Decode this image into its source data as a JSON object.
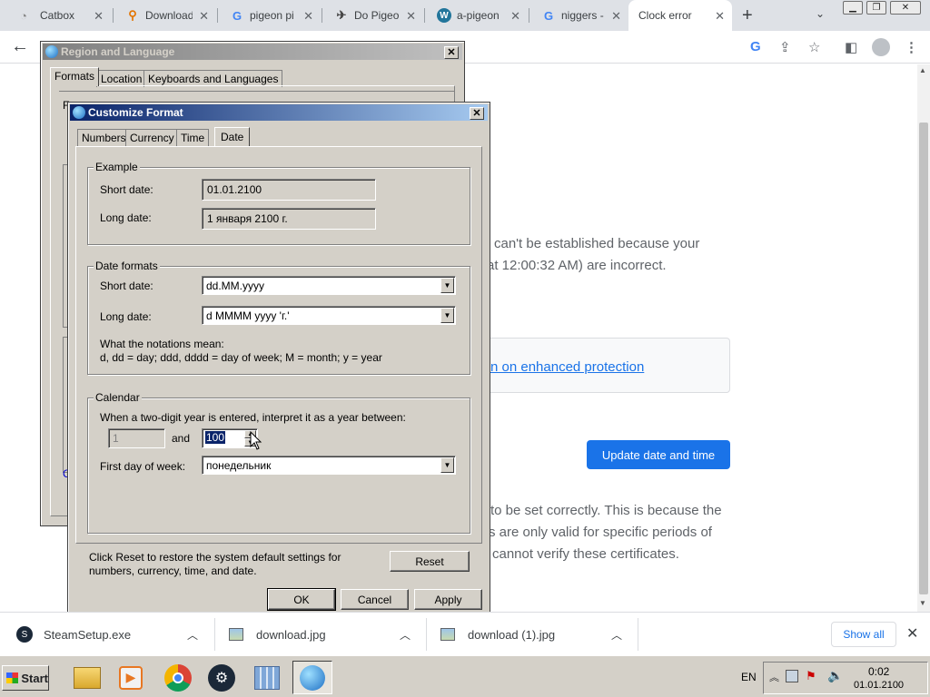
{
  "browser": {
    "tabs": [
      {
        "title": "Catbox",
        "icon": "catbox-icon"
      },
      {
        "title": "Download",
        "icon": "search-favicon-icon"
      },
      {
        "title": "pigeon pi",
        "icon": "google-icon"
      },
      {
        "title": "Do Pigeo",
        "icon": "bird-icon"
      },
      {
        "title": "a-pigeon",
        "icon": "wordpress-icon"
      },
      {
        "title": "niggers -",
        "icon": "google-icon"
      },
      {
        "title": "Clock error",
        "icon": "blank-icon"
      }
    ],
    "new_tab": "+"
  },
  "error_page": {
    "line1": "can't be established because your",
    "line2": "at 12:00:32 AM) are incorrect.",
    "protect_link": "rn on enhanced protection",
    "update_button": "Update date and time",
    "para1": "to be set correctly. This is because the",
    "para2": "s are only valid for specific periods of",
    "para3": "cannot verify these certificates."
  },
  "region_dialog": {
    "title": "Region and Language",
    "tabs": [
      "Formats",
      "Location",
      "Keyboards and Languages"
    ],
    "partial_letters": [
      "F",
      "C"
    ]
  },
  "customize_dialog": {
    "title": "Customize Format",
    "tabs": [
      "Numbers",
      "Currency",
      "Time",
      "Date"
    ],
    "selected_tab": "Date",
    "example": {
      "legend": "Example",
      "short_label": "Short date:",
      "short_value": "01.01.2100",
      "long_label": "Long date:",
      "long_value": "1 января 2100 г."
    },
    "formats": {
      "legend": "Date formats",
      "short_label": "Short date:",
      "short_value": "dd.MM.yyyy",
      "long_label": "Long date:",
      "long_value": "d MMMM yyyy 'г.'",
      "notation_heading": "What the notations mean:",
      "notation_text": "d, dd = day;  ddd, dddd = day of week;  M = month;  y = year"
    },
    "calendar": {
      "legend": "Calendar",
      "twodigit_text": "When a two-digit year is entered, interpret it as a year between:",
      "from_value": "1",
      "and_label": "and",
      "to_value": "100",
      "first_day_label": "First day of week:",
      "first_day_value": "понедельник"
    },
    "reset_text_1": "Click Reset to restore the system default settings for",
    "reset_text_2": "numbers, currency, time, and date.",
    "reset_button": "Reset",
    "ok_button": "OK",
    "cancel_button": "Cancel",
    "apply_button": "Apply"
  },
  "downloads": {
    "items": [
      {
        "name": "SteamSetup.exe",
        "icon": "steam-icon"
      },
      {
        "name": "download.jpg",
        "icon": "image-file-icon"
      },
      {
        "name": "download (1).jpg",
        "icon": "image-file-icon"
      }
    ],
    "show_all": "Show all"
  },
  "taskbar": {
    "start": "Start",
    "language": "EN",
    "time": "0:02",
    "date": "01.01.2100"
  }
}
